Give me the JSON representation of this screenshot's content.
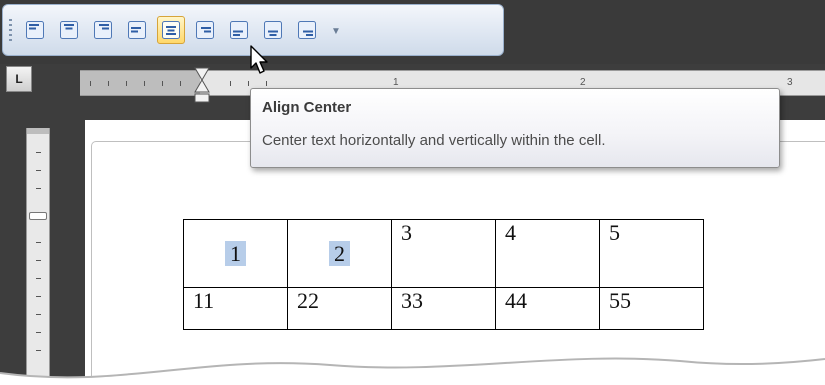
{
  "toolbar": {
    "buttons": [
      {
        "name": "align-top-left",
        "icon": "align-top-left-icon"
      },
      {
        "name": "align-top-center",
        "icon": "align-top-center-icon"
      },
      {
        "name": "align-top-right",
        "icon": "align-top-right-icon"
      },
      {
        "name": "align-middle-left",
        "icon": "align-middle-left-icon"
      },
      {
        "name": "align-center",
        "icon": "align-center-icon",
        "active": true
      },
      {
        "name": "align-middle-right",
        "icon": "align-middle-right-icon"
      },
      {
        "name": "align-bottom-left",
        "icon": "align-bottom-left-icon"
      },
      {
        "name": "align-bottom-center",
        "icon": "align-bottom-center-icon"
      },
      {
        "name": "align-bottom-right",
        "icon": "align-bottom-right-icon"
      }
    ],
    "dropdown_glyph": "▼"
  },
  "ruler": {
    "corner_label": "L",
    "numbers": [
      "1",
      "2",
      "3"
    ]
  },
  "tooltip": {
    "title": "Align Center",
    "description": "Center text horizontally and vertically within the cell."
  },
  "table": {
    "rows": [
      [
        "1",
        "2",
        "3",
        "4",
        "5"
      ],
      [
        "11",
        "22",
        "33",
        "44",
        "55"
      ]
    ]
  },
  "colors": {
    "toolbar_bg": "#dfe7f2",
    "active_button": "#ffd86a",
    "selection": "#b7cde9",
    "dark_chrome": "#3d3d3d"
  }
}
